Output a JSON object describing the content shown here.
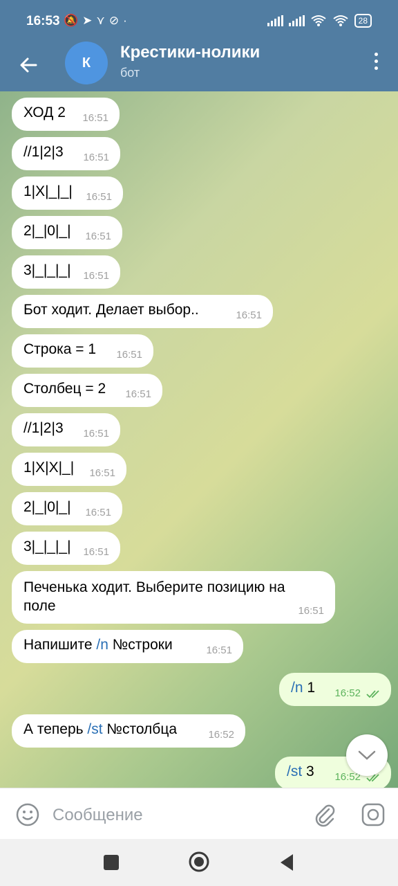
{
  "status_bar": {
    "time": "16:53",
    "battery": "28"
  },
  "header": {
    "avatar_letter": "К",
    "title": "Крестики-нолики",
    "subtitle": "бот"
  },
  "messages": [
    {
      "text": "ХОД 2",
      "time": "16:51"
    },
    {
      "text": "//1|2|3",
      "time": "16:51"
    },
    {
      "text": "1|X|_|_|",
      "time": "16:51"
    },
    {
      "text": "2|_|0|_|",
      "time": "16:51"
    },
    {
      "text": "3|_|_|_|",
      "time": "16:51"
    },
    {
      "text": "Бот ходит. Делает выбор..",
      "time": "16:51"
    },
    {
      "text": "Строка = 1",
      "time": "16:51"
    },
    {
      "text": "Столбец = 2",
      "time": "16:51"
    },
    {
      "text": "//1|2|3",
      "time": "16:51"
    },
    {
      "text": "1|X|X|_|",
      "time": "16:51"
    },
    {
      "text": "2|_|0|_|",
      "time": "16:51"
    },
    {
      "text": "3|_|_|_|",
      "time": "16:51"
    },
    {
      "text": "Печенька ходит. Выберите позицию на\nполе",
      "time": "16:51"
    },
    {
      "text_before": "Напишите ",
      "cmd": "/n",
      "text_after": " №строки",
      "time": "16:51"
    },
    {
      "cmd": "/n",
      "text_after": " 1",
      "time": "16:52"
    },
    {
      "text_before": "А теперь ",
      "cmd": "/st",
      "text_after": " №столбца",
      "time": "16:52"
    },
    {
      "cmd": "/st",
      "text_after": " 3",
      "time": "16:52"
    }
  ],
  "input": {
    "placeholder": "Сообщение"
  }
}
